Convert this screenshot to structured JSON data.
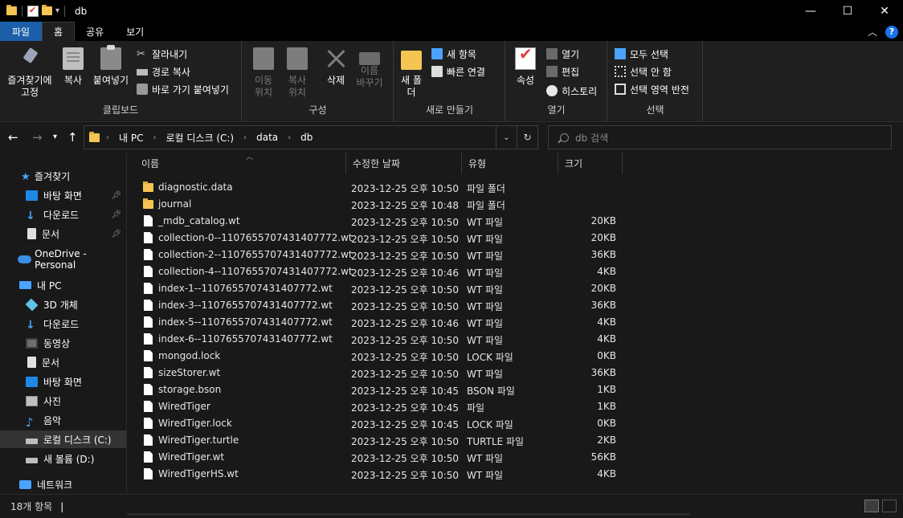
{
  "window": {
    "title": "db",
    "minimize_glyph": "—",
    "maximize_glyph": "☐",
    "close_glyph": "✕"
  },
  "ribbon_tabs": [
    {
      "label": "파일"
    },
    {
      "label": "홈"
    },
    {
      "label": "공유"
    },
    {
      "label": "보기"
    }
  ],
  "ribbon": {
    "clipboard": {
      "label": "클립보드",
      "pin": "즐겨찾기에 고정",
      "copy": "복사",
      "paste": "붙여넣기",
      "cut": "잘라내기",
      "copy_path": "경로 복사",
      "paste_shortcut": "바로 가기 붙여넣기"
    },
    "organize": {
      "label": "구성",
      "move_to": "이동 위치",
      "copy_to": "복사 위치",
      "delete": "삭제",
      "rename": "이름 바꾸기"
    },
    "new": {
      "label": "새로 만들기",
      "new_folder": "새 폴더",
      "new_item": "새 항목",
      "easy_access": "빠른 연결"
    },
    "open": {
      "label": "열기",
      "properties": "속성",
      "open": "열기",
      "edit": "편집",
      "history": "히스토리"
    },
    "select": {
      "label": "선택",
      "select_all": "모두 선택",
      "select_none": "선택 안 함",
      "invert": "선택 영역 반전"
    }
  },
  "address": {
    "crumbs": [
      "내 PC",
      "로컬 디스크 (C:)",
      "data",
      "db"
    ],
    "search_placeholder": "db 검색"
  },
  "nav_pane": {
    "items": [
      {
        "label": "즐겨찾기",
        "icon": "star-icon"
      },
      {
        "label": "바탕 화면",
        "icon": "desktop-icon",
        "pinned": true
      },
      {
        "label": "다운로드",
        "icon": "download-icon",
        "pinned": true
      },
      {
        "label": "문서",
        "icon": "document-icon",
        "pinned": true
      },
      {
        "label": "OneDrive - Personal",
        "icon": "cloud-icon"
      },
      {
        "label": "내 PC",
        "icon": "pc-icon"
      },
      {
        "label": "3D 개체",
        "icon": "3d-objects-icon"
      },
      {
        "label": "다운로드",
        "icon": "download-icon"
      },
      {
        "label": "동영상",
        "icon": "video-icon"
      },
      {
        "label": "문서",
        "icon": "document-icon"
      },
      {
        "label": "바탕 화면",
        "icon": "desktop-icon"
      },
      {
        "label": "사진",
        "icon": "pictures-icon"
      },
      {
        "label": "음악",
        "icon": "music-icon"
      },
      {
        "label": "로컬 디스크 (C:)",
        "icon": "drive-icon",
        "selected": true
      },
      {
        "label": "새 볼륨 (D:)",
        "icon": "drive-icon"
      },
      {
        "label": "네트워크",
        "icon": "network-icon"
      }
    ]
  },
  "file_list": {
    "columns": {
      "name": "이름",
      "modified": "수정한 날짜",
      "type": "유형",
      "size": "크기"
    },
    "rows": [
      {
        "name": "diagnostic.data",
        "modified": "2023-12-25 오후 10:50",
        "type": "파일 폴더",
        "size": "",
        "kind": "folder"
      },
      {
        "name": "journal",
        "modified": "2023-12-25 오후 10:48",
        "type": "파일 폴더",
        "size": "",
        "kind": "folder"
      },
      {
        "name": "_mdb_catalog.wt",
        "modified": "2023-12-25 오후 10:50",
        "type": "WT 파일",
        "size": "20KB",
        "kind": "file"
      },
      {
        "name": "collection-0--1107655707431407772.wt",
        "modified": "2023-12-25 오후 10:50",
        "type": "WT 파일",
        "size": "20KB",
        "kind": "file"
      },
      {
        "name": "collection-2--1107655707431407772.wt",
        "modified": "2023-12-25 오후 10:50",
        "type": "WT 파일",
        "size": "36KB",
        "kind": "file"
      },
      {
        "name": "collection-4--1107655707431407772.wt",
        "modified": "2023-12-25 오후 10:46",
        "type": "WT 파일",
        "size": "4KB",
        "kind": "file"
      },
      {
        "name": "index-1--1107655707431407772.wt",
        "modified": "2023-12-25 오후 10:50",
        "type": "WT 파일",
        "size": "20KB",
        "kind": "file"
      },
      {
        "name": "index-3--1107655707431407772.wt",
        "modified": "2023-12-25 오후 10:50",
        "type": "WT 파일",
        "size": "36KB",
        "kind": "file"
      },
      {
        "name": "index-5--1107655707431407772.wt",
        "modified": "2023-12-25 오후 10:46",
        "type": "WT 파일",
        "size": "4KB",
        "kind": "file"
      },
      {
        "name": "index-6--1107655707431407772.wt",
        "modified": "2023-12-25 오후 10:50",
        "type": "WT 파일",
        "size": "4KB",
        "kind": "file"
      },
      {
        "name": "mongod.lock",
        "modified": "2023-12-25 오후 10:50",
        "type": "LOCK 파일",
        "size": "0KB",
        "kind": "file"
      },
      {
        "name": "sizeStorer.wt",
        "modified": "2023-12-25 오후 10:50",
        "type": "WT 파일",
        "size": "36KB",
        "kind": "file"
      },
      {
        "name": "storage.bson",
        "modified": "2023-12-25 오후 10:45",
        "type": "BSON 파일",
        "size": "1KB",
        "kind": "file"
      },
      {
        "name": "WiredTiger",
        "modified": "2023-12-25 오후 10:45",
        "type": "파일",
        "size": "1KB",
        "kind": "file"
      },
      {
        "name": "WiredTiger.lock",
        "modified": "2023-12-25 오후 10:45",
        "type": "LOCK 파일",
        "size": "0KB",
        "kind": "file"
      },
      {
        "name": "WiredTiger.turtle",
        "modified": "2023-12-25 오후 10:50",
        "type": "TURTLE 파일",
        "size": "2KB",
        "kind": "file"
      },
      {
        "name": "WiredTiger.wt",
        "modified": "2023-12-25 오후 10:50",
        "type": "WT 파일",
        "size": "56KB",
        "kind": "file"
      },
      {
        "name": "WiredTigerHS.wt",
        "modified": "2023-12-25 오후 10:50",
        "type": "WT 파일",
        "size": "4KB",
        "kind": "file"
      }
    ]
  },
  "status": {
    "item_count": "18개 항목"
  },
  "colors": {
    "file_tab": "#1a5fa8",
    "folder": "#f4c552",
    "accent": "#4aa3ff"
  }
}
